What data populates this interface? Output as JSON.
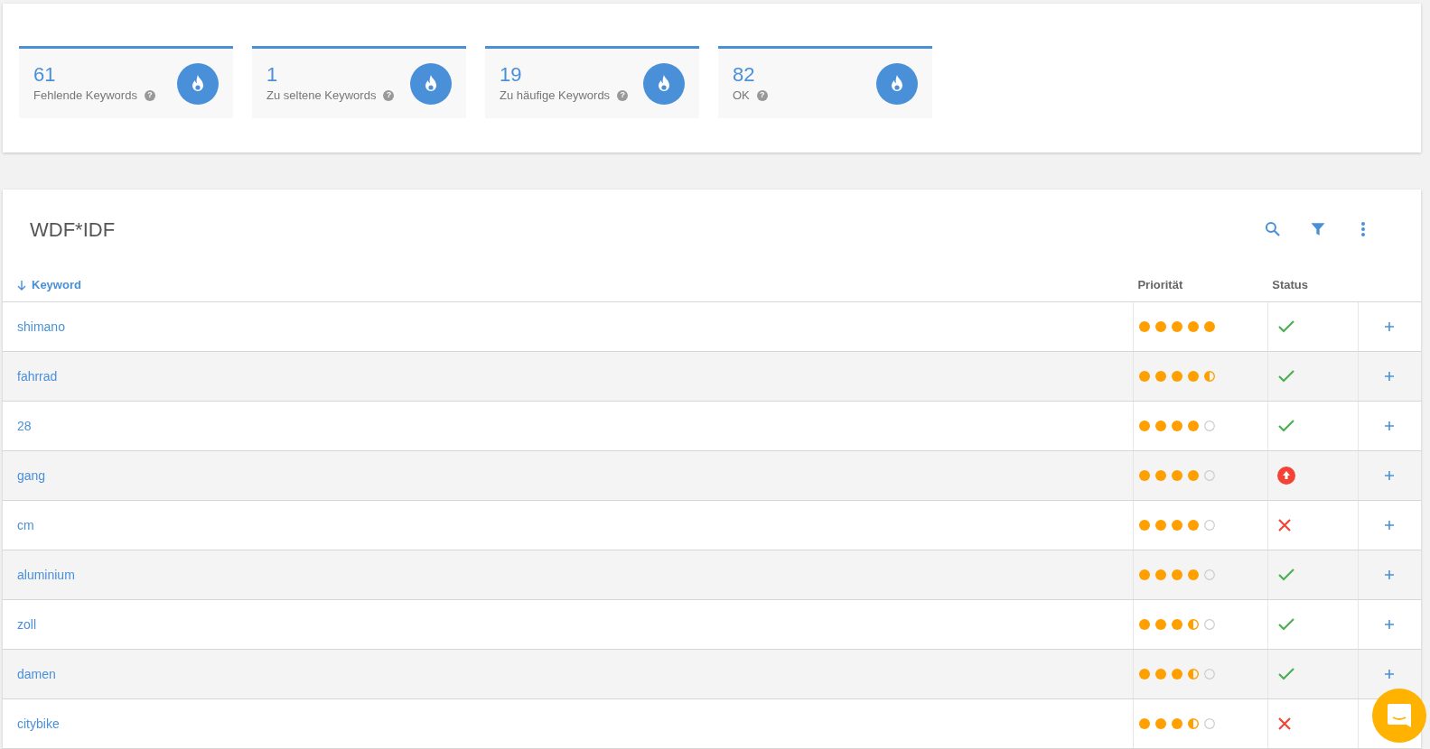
{
  "stats": [
    {
      "value": "61",
      "label": "Fehlende Keywords",
      "help": "?"
    },
    {
      "value": "1",
      "label": "Zu seltene Keywords",
      "help": "?"
    },
    {
      "value": "19",
      "label": "Zu häufige Keywords",
      "help": "?"
    },
    {
      "value": "82",
      "label": "OK",
      "help": "?"
    }
  ],
  "table": {
    "title": "WDF*IDF",
    "columns": [
      {
        "label": "Keyword",
        "sorted": true
      },
      {
        "label": "Priorität",
        "sorted": false
      },
      {
        "label": "Status",
        "sorted": false
      }
    ],
    "rows": [
      {
        "keyword": "shimano",
        "stars": 5,
        "kind": "ok"
      },
      {
        "keyword": "fahrrad",
        "stars": 4.5,
        "kind": "ok"
      },
      {
        "keyword": "28",
        "stars": 4,
        "kind": "ok"
      },
      {
        "keyword": "gang",
        "stars": 4,
        "kind": "increase"
      },
      {
        "keyword": "cm",
        "stars": 4,
        "kind": "missing"
      },
      {
        "keyword": "aluminium",
        "stars": 4,
        "kind": "ok"
      },
      {
        "keyword": "zoll",
        "stars": 3.5,
        "kind": "ok"
      },
      {
        "keyword": "damen",
        "stars": 3.5,
        "kind": "ok"
      },
      {
        "keyword": "citybike",
        "stars": 3.5,
        "kind": "missing"
      }
    ]
  }
}
